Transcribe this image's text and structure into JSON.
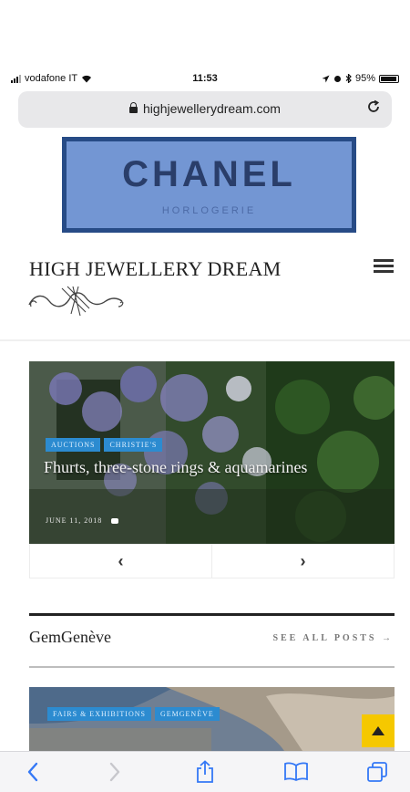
{
  "status_bar": {
    "carrier": "vodafone IT",
    "time": "11:53",
    "battery": "95%",
    "battery_level": 0.95
  },
  "url_bar": {
    "url": "highjewellerydream.com"
  },
  "ad_banner": {
    "brand": "CHANEL",
    "subtitle": "HORLOGERIE",
    "colors": {
      "background": "#7396d3",
      "border": "#274b86"
    }
  },
  "header": {
    "site_title": "HIGH JEWELLERY DREAM",
    "menu_icon": "hamburger-icon",
    "logo_icon": "flourish-logo"
  },
  "slider": {
    "tags": [
      "AUCTIONS",
      "CHRISTIE'S"
    ],
    "title": "Fhurts, three-stone rings & aquamarines",
    "date": "JUNE 11, 2018",
    "comments_icon": "comment-icon",
    "prev_label": "‹",
    "next_label": "›"
  },
  "section": {
    "title": "GemGenève",
    "see_all": "SEE ALL POSTS →"
  },
  "post_card": {
    "tags": [
      "FAIRS & EXHIBITIONS",
      "GEMGENÈVE"
    ]
  },
  "back_to_top": {
    "icon": "arrow-up-icon",
    "color": "#f5c800"
  },
  "toolbar": {
    "items": [
      "back-icon",
      "forward-icon",
      "share-icon",
      "bookmarks-icon",
      "tabs-icon"
    ]
  },
  "colors": {
    "tag_blue": "#2c8bd0",
    "accent_yellow": "#f5c800"
  }
}
